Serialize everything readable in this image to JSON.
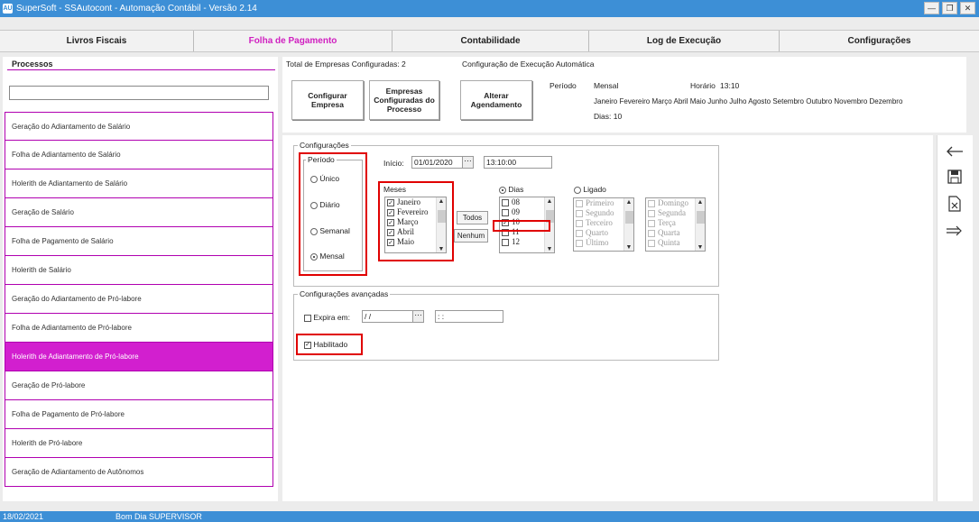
{
  "window": {
    "title": "SuperSoft - SSAutocont - Automação Contábil - Versão 2.14",
    "logo": "AU"
  },
  "menu": [
    "Livros Fiscais",
    "Folha de Pagamento",
    "Contabilidade",
    "Log de Execução",
    "Configurações"
  ],
  "processes": {
    "title": "Processos",
    "search_value": "",
    "items": [
      "Geração do Adiantamento de Salário",
      "Folha de Adiantamento de Salário",
      "Holerith de Adiantamento de Salário",
      "Geração de Salário",
      "Folha de Pagamento de Salário",
      "Holerith de Salário",
      "Geração do Adiantamento de Pró-labore",
      "Folha de Adiantamento de Pró-labore",
      "Holerith de Adiantamento de Pró-labore",
      "Geração de Pró-labore",
      "Folha de Pagamento de Pró-labore",
      "Holerith de Pró-labore",
      "Geração de Adiantamento de Autônomos"
    ],
    "selected_index": 8
  },
  "top": {
    "total_label": "Total de Empresas Configuradas: 2",
    "btn_configurar": "Configurar Empresa",
    "btn_empresas": "Empresas Configuradas do Processo",
    "auto_label": "Configuração de Execução Automática",
    "btn_alterar": "Alterar Agendamento",
    "periodo_label": "Período",
    "periodo_value": "Mensal",
    "horario_label": "Horário",
    "horario_value": "13:10",
    "meses_value": "Janeiro Fevereiro Março Abril Maio Junho Julho Agosto Setembro Outubro Novembro Dezembro",
    "dias_value": "Dias: 10"
  },
  "config": {
    "legend": "Configurações",
    "periodo_legend": "Período",
    "periodos": [
      "Único",
      "Diário",
      "Semanal",
      "Mensal"
    ],
    "periodo_selected": 3,
    "inicio_label": "Início:",
    "inicio_date": "01/01/2020",
    "inicio_time": "13:10:00",
    "meses_legend": "Meses",
    "meses": [
      "Janeiro",
      "Fevereiro",
      "Março",
      "Abril",
      "Maio"
    ],
    "btn_todos": "Todos",
    "btn_nenhum": "Nenhum",
    "dias_radio": "Dias",
    "ligado_radio": "Ligado",
    "dias": [
      "08",
      "09",
      "10",
      "11",
      "12"
    ],
    "dias_checked": "10",
    "ordinals": [
      "Primeiro",
      "Segundo",
      "Terceiro",
      "Quarto",
      "Último"
    ],
    "weekdays": [
      "Domingo",
      "Segunda",
      "Terça",
      "Quarta",
      "Quinta"
    ]
  },
  "advanced": {
    "legend": "Configurações avançadas",
    "expira_label": "Expira em:",
    "expira_date": " / /",
    "expira_time": " : :",
    "habilitado_label": "Habilitado"
  },
  "status": {
    "date": "18/02/2021",
    "greeting": "Bom Dia SUPERVISOR"
  },
  "colors": {
    "accent": "#d21fcf",
    "titlebar": "#3d8fd6",
    "highlight": "#e00000"
  }
}
